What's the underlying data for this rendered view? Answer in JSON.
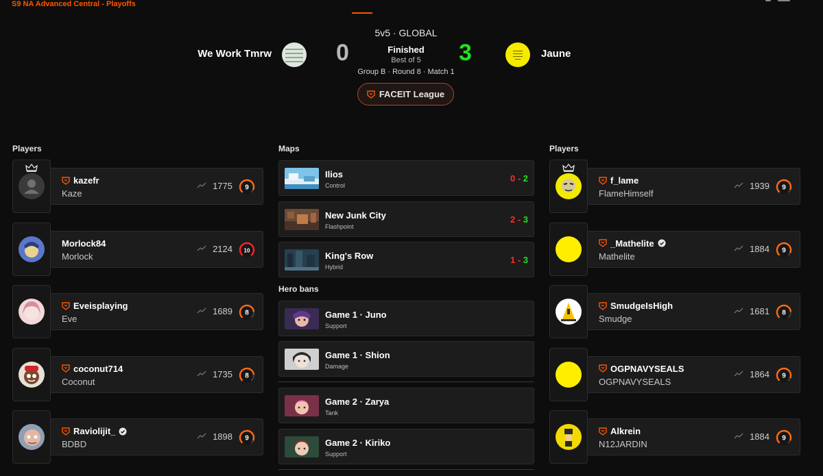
{
  "event_title": "S9 NA Advanced Central - Playoffs",
  "match": {
    "mode": "5v5 · GLOBAL",
    "team_a": {
      "name": "We Work Tmrw",
      "score": "0"
    },
    "team_b": {
      "name": "Jaune",
      "score": "3"
    },
    "status": "Finished",
    "best_of": "Best of 5",
    "round_info": "Group B · Round 8 · Match 1",
    "league_button": "FACEIT League"
  },
  "sections": {
    "players_left": "Players",
    "maps": "Maps",
    "hero_bans": "Hero bans",
    "players_right": "Players"
  },
  "left_players": [
    {
      "nickname": "kazefr",
      "name": "Kaze",
      "elo": "1775",
      "level": "9",
      "captain": true,
      "verified": false,
      "faceit": true
    },
    {
      "nickname": "Morlock84",
      "name": "Morlock",
      "elo": "2124",
      "level": "10",
      "captain": false,
      "verified": false,
      "faceit": false
    },
    {
      "nickname": "Eveisplaying",
      "name": "Eve",
      "elo": "1689",
      "level": "8",
      "captain": false,
      "verified": false,
      "faceit": true
    },
    {
      "nickname": "coconut714",
      "name": "Coconut",
      "elo": "1735",
      "level": "8",
      "captain": false,
      "verified": false,
      "faceit": true
    },
    {
      "nickname": "Raviolijit_",
      "name": "BDBD",
      "elo": "1898",
      "level": "9",
      "captain": false,
      "verified": true,
      "faceit": true
    }
  ],
  "right_players": [
    {
      "nickname": "f_lame",
      "name": "FlameHimself",
      "elo": "1939",
      "level": "9",
      "captain": true,
      "verified": false,
      "faceit": true
    },
    {
      "nickname": "_Mathelite",
      "name": "Mathelite",
      "elo": "1884",
      "level": "9",
      "captain": false,
      "verified": true,
      "faceit": true
    },
    {
      "nickname": "SmudgeIsHigh",
      "name": "Smudge",
      "elo": "1681",
      "level": "8",
      "captain": false,
      "verified": false,
      "faceit": true
    },
    {
      "nickname": "OGPNAVYSEALS",
      "name": "OGPNAVYSEALS",
      "elo": "1864",
      "level": "9",
      "captain": false,
      "verified": false,
      "faceit": true
    },
    {
      "nickname": "Alkrein",
      "name": "N12JARDIN",
      "elo": "1884",
      "level": "9",
      "captain": false,
      "verified": false,
      "faceit": true
    }
  ],
  "maps": [
    {
      "name": "Ilios",
      "mode": "Control",
      "score_a": "0",
      "score_b": "2"
    },
    {
      "name": "New Junk City",
      "mode": "Flashpoint",
      "score_a": "2",
      "score_b": "3"
    },
    {
      "name": "King's Row",
      "mode": "Hybrid",
      "score_a": "1",
      "score_b": "3"
    }
  ],
  "hero_bans": [
    {
      "title": "Game 1 · Juno",
      "role": "Support"
    },
    {
      "title": "Game 1 · Shion",
      "role": "Damage"
    },
    {
      "title": "Game 2 · Zarya",
      "role": "Tank"
    },
    {
      "title": "Game 2 · Kiriko",
      "role": "Support"
    }
  ],
  "colors": {
    "accent": "#ff5500",
    "win": "#1fe21f",
    "loss": "#ff2b2b",
    "card": "#1c1c1c",
    "background": "#0d0d0d"
  },
  "icons": {
    "faceit": "faceit-shield-icon",
    "verified": "verified-badge-icon",
    "captain": "crown-icon",
    "trend": "trend-line-icon",
    "level": "skill-level-gauge-icon"
  }
}
